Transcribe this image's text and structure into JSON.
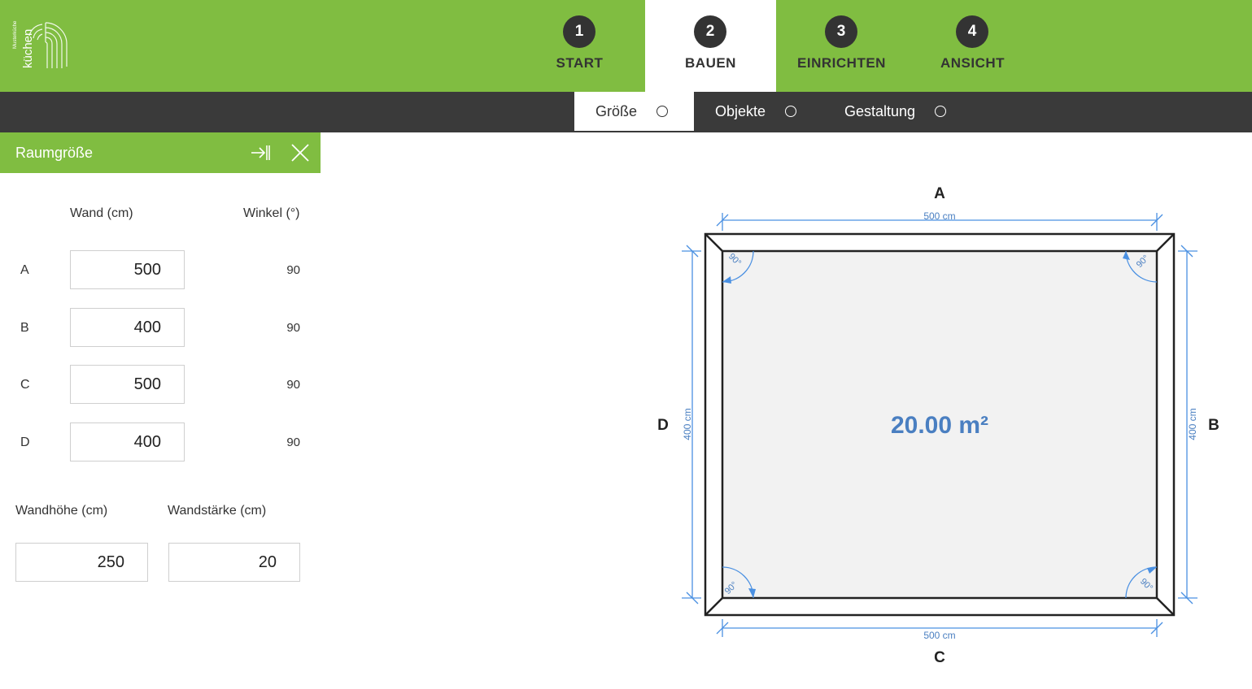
{
  "brand": {
    "name": "küchen",
    "tagline": "Musterküche"
  },
  "steps": [
    {
      "number": "1",
      "label": "START"
    },
    {
      "number": "2",
      "label": "BAUEN"
    },
    {
      "number": "3",
      "label": "EINRICHTEN"
    },
    {
      "number": "4",
      "label": "ANSICHT"
    }
  ],
  "active_step": "BAUEN",
  "subtabs": [
    {
      "label": "Größe"
    },
    {
      "label": "Objekte"
    },
    {
      "label": "Gestaltung"
    }
  ],
  "active_subtab": "Größe",
  "panel": {
    "title": "Raumgröße",
    "col_wall": "Wand (cm)",
    "col_angle": "Winkel (°)",
    "rows": [
      {
        "label": "A",
        "wall": "500",
        "angle": "90"
      },
      {
        "label": "B",
        "wall": "400",
        "angle": "90"
      },
      {
        "label": "C",
        "wall": "500",
        "angle": "90"
      },
      {
        "label": "D",
        "wall": "400",
        "angle": "90"
      }
    ],
    "height_label": "Wandhöhe (cm)",
    "height_value": "250",
    "thickness_label": "Wandstärke (cm)",
    "thickness_value": "20"
  },
  "plan": {
    "area": "20.00 m²",
    "wall_labels": {
      "top": "A",
      "right": "B",
      "bottom": "C",
      "left": "D"
    },
    "dims": {
      "top": "500 cm",
      "right": "400 cm",
      "bottom": "500 cm",
      "left": "400 cm"
    },
    "corner_angle": "90°",
    "colors": {
      "dimension": "#4a90e2",
      "area_text": "#4a7fc1",
      "floor": "#f2f2f2",
      "wall": "#222222"
    }
  },
  "colors": {
    "brand_green": "#80bd41",
    "dark_bar": "#3a3a3a"
  }
}
